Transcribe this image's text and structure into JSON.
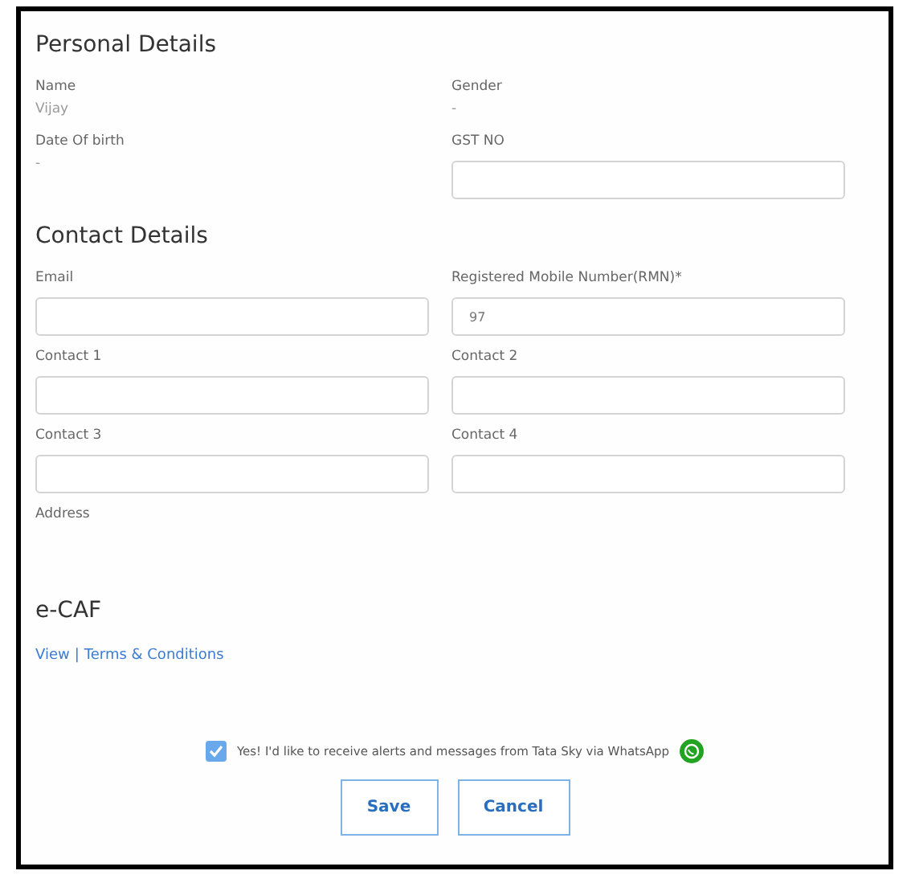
{
  "sections": [
    {
      "title": "Personal Details",
      "fields": [
        {
          "label": "Name",
          "kind": "text",
          "value": "Vijay"
        },
        {
          "label": "Gender",
          "kind": "text",
          "value": "-"
        },
        {
          "label": "Date Of birth",
          "kind": "text",
          "value": "-"
        },
        {
          "label": "GST NO",
          "kind": "input"
        }
      ]
    },
    {
      "title": "Contact Details",
      "fields": [
        {
          "label": "Email",
          "kind": "input"
        },
        {
          "label": "Registered Mobile Number(RMN)*",
          "kind": "input",
          "value": "97"
        },
        {
          "label": "Contact 1",
          "kind": "input"
        },
        {
          "label": "Contact 2",
          "kind": "input"
        },
        {
          "label": "Contact 3",
          "kind": "input"
        },
        {
          "label": "Contact 4",
          "kind": "input"
        },
        {
          "label": "Address",
          "kind": "label"
        }
      ]
    }
  ],
  "ecaf": {
    "title": "e-CAF",
    "links": [
      "View",
      "Terms & Conditions"
    ],
    "separator": "|"
  },
  "consent": {
    "text": "Yes! I'd like to receive alerts and messages from Tata Sky via WhatsApp",
    "checked": true
  },
  "buttons": [
    "Save",
    "Cancel"
  ]
}
